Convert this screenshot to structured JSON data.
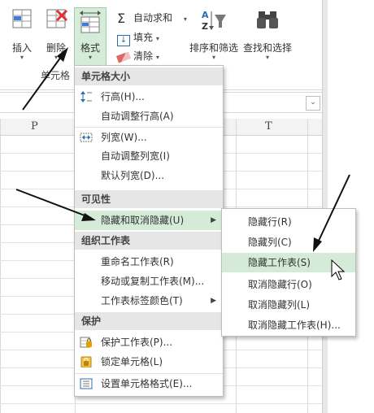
{
  "ribbon": {
    "insert": "插入",
    "delete": "删除",
    "format": "格式",
    "cells_group": "单元格",
    "autosum": "自动求和",
    "fill": "填充",
    "clear": "清除",
    "sort_filter": "排序和筛选",
    "find_select": "查找和选择"
  },
  "columns": [
    "P",
    "T"
  ],
  "format_menu": {
    "cell_size_header": "单元格大小",
    "row_height": "行高(H)...",
    "autofit_row": "自动调整行高(A)",
    "col_width": "列宽(W)...",
    "autofit_col": "自动调整列宽(I)",
    "default_width": "默认列宽(D)...",
    "visibility_header": "可见性",
    "hide_unhide": "隐藏和取消隐藏(U)",
    "organize_header": "组织工作表",
    "rename_sheet": "重命名工作表(R)",
    "move_copy": "移动或复制工作表(M)...",
    "tab_color": "工作表标签颜色(T)",
    "protect_header": "保护",
    "protect_sheet": "保护工作表(P)...",
    "lock_cell": "锁定单元格(L)",
    "format_cells": "设置单元格格式(E)..."
  },
  "submenu": {
    "hide_rows": "隐藏行(R)",
    "hide_cols": "隐藏列(C)",
    "hide_sheet": "隐藏工作表(S)",
    "unhide_rows": "取消隐藏行(O)",
    "unhide_cols": "取消隐藏列(L)",
    "unhide_sheet": "取消隐藏工作表(H)..."
  },
  "colors": {
    "highlight": "#d4ecd7",
    "accent_green": "#2e8b57",
    "icon_blue": "#2b6cb0"
  }
}
